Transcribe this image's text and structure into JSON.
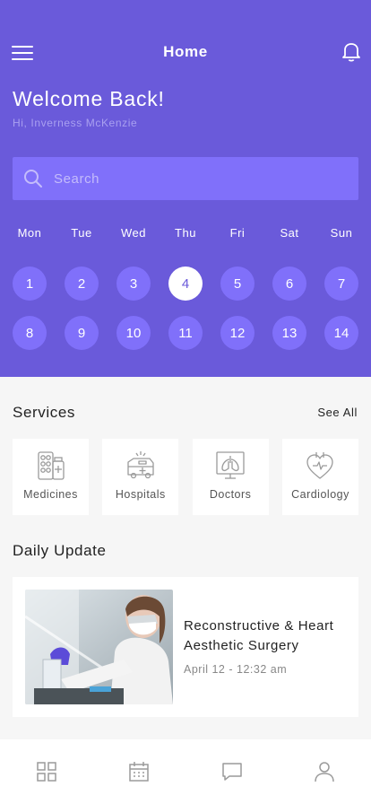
{
  "header": {
    "title": "Home",
    "welcome": "Welcome Back!",
    "greeting": "Hi, Inverness McKenzie",
    "menu_icon": "hamburger-icon",
    "notification_icon": "bell-icon"
  },
  "search": {
    "placeholder": "Search",
    "icon": "search-icon"
  },
  "calendar": {
    "weekdays": [
      "Mon",
      "Tue",
      "Wed",
      "Thu",
      "Fri",
      "Sat",
      "Sun"
    ],
    "week1": [
      "1",
      "2",
      "3",
      "4",
      "5",
      "6",
      "7"
    ],
    "week2": [
      "8",
      "9",
      "10",
      "11",
      "12",
      "13",
      "14"
    ],
    "selected_day": "4"
  },
  "services": {
    "title": "Services",
    "see_all": "See All",
    "items": [
      {
        "label": "Medicines",
        "icon": "medicines-icon"
      },
      {
        "label": "Hospitals",
        "icon": "ambulance-icon"
      },
      {
        "label": "Doctors",
        "icon": "lungs-monitor-icon"
      },
      {
        "label": "Cardiology",
        "icon": "heart-icon"
      }
    ]
  },
  "daily_update": {
    "title": "Daily Update",
    "card": {
      "title": "Reconstructive & Heart Aesthetic Surgery",
      "date": "April 12 - 12:32 am"
    }
  },
  "bottom_nav": [
    "grid-icon",
    "calendar-icon",
    "chat-icon",
    "profile-icon"
  ],
  "colors": {
    "primary": "#6a5ada",
    "primary_light": "#8070fa",
    "background": "#f6f6f6",
    "icon_gray": "#9a9a9a"
  }
}
